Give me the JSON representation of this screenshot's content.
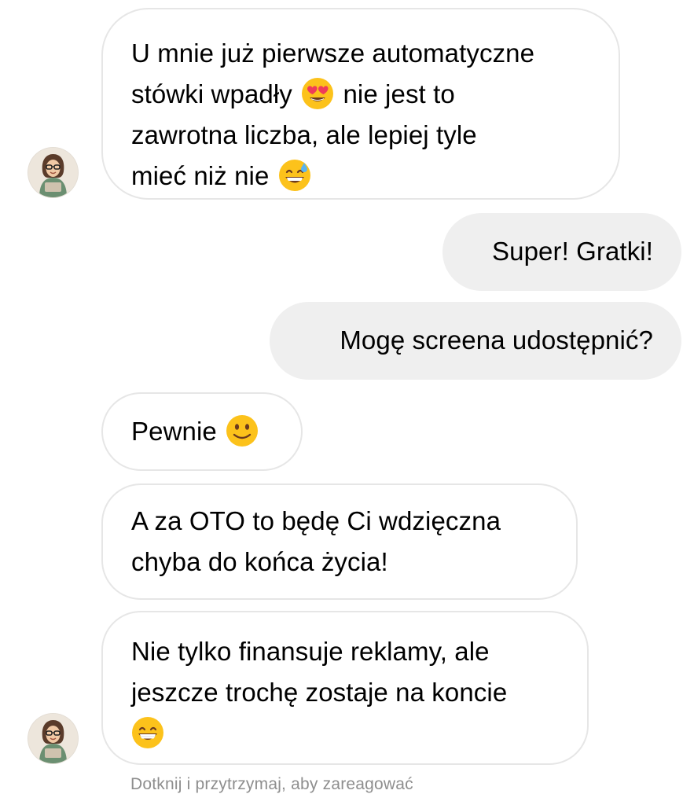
{
  "conversation": {
    "messages": [
      {
        "sender": "other",
        "lines": [
          "U mnie już pierwsze automatyczne",
          "stówki wpadły",
          "nie jest to",
          "zawrotna liczba, ale lepiej tyle",
          "mieć niż nie"
        ],
        "emojis": [
          "heart-eyes",
          "grinning-sweat"
        ]
      },
      {
        "sender": "me",
        "lines": [
          "Super! Gratki!"
        ]
      },
      {
        "sender": "me",
        "lines": [
          "Mogę screena udostępnić?"
        ]
      },
      {
        "sender": "other",
        "lines": [
          "Pewnie"
        ],
        "emojis": [
          "slightly-smiling"
        ]
      },
      {
        "sender": "other",
        "lines": [
          "A za OTO to będę Ci wdzięczna",
          "chyba do końca życia!"
        ]
      },
      {
        "sender": "other",
        "lines": [
          "Nie tylko finansuje reklamy, ale",
          "jeszcze trochę zostaje na koncie"
        ],
        "emojis": [
          "grinning"
        ]
      }
    ],
    "hint": "Dotknij i przytrzymaj, aby zareagować"
  },
  "colors": {
    "incoming_bg": "#ffffff",
    "incoming_border": "#e6e6e6",
    "outgoing_bg": "#efefef",
    "hint_text": "#8e8e8e",
    "emoji_face": "#fcc21b"
  },
  "icons": [
    "avatar",
    "heart-eyes-emoji",
    "grinning-sweat-emoji",
    "slightly-smiling-emoji",
    "grinning-emoji"
  ]
}
